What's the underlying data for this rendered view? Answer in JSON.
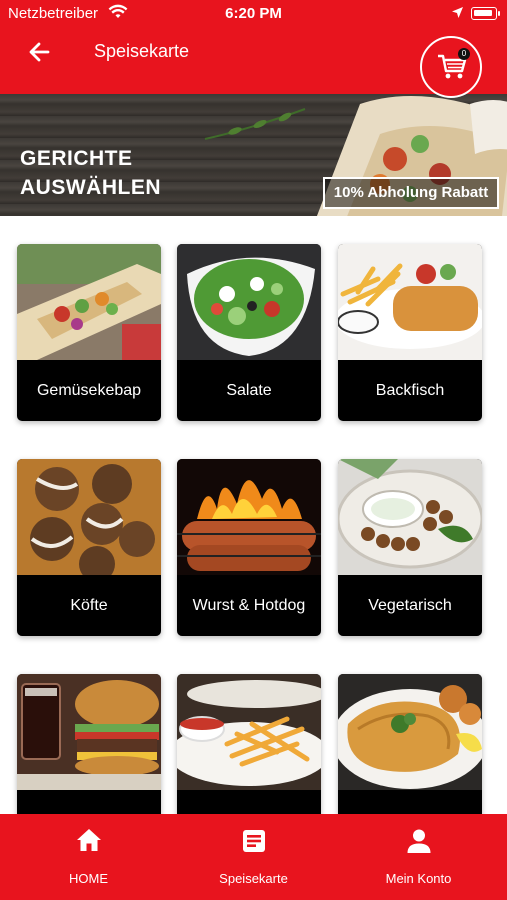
{
  "status_bar": {
    "carrier": "Netzbetreiber",
    "time": "6:20 PM"
  },
  "header": {
    "title": "Speisekarte",
    "cart_count": "0"
  },
  "banner": {
    "line1": "GERICHTE",
    "line2": "AUSWÄHLEN",
    "promo": "10% Abholung Rabatt"
  },
  "categories": [
    {
      "label": "Gemüsekebap",
      "image": "wrap-photo"
    },
    {
      "label": "Salate",
      "image": "salad-photo"
    },
    {
      "label": "Backfisch",
      "image": "fried-fish-photo"
    },
    {
      "label": "Köfte",
      "image": "meatballs-photo"
    },
    {
      "label": "Wurst & Hotdog",
      "image": "grill-sausage-photo"
    },
    {
      "label": "Vegetarisch",
      "image": "falafel-photo"
    },
    {
      "label": "",
      "image": "burger-photo"
    },
    {
      "label": "",
      "image": "fries-photo"
    },
    {
      "label": "",
      "image": "schnitzel-photo"
    }
  ],
  "tabbar": {
    "home": "HOME",
    "menu": "Speisekarte",
    "account": "Mein Konto"
  },
  "colors": {
    "brand_red": "#e8141e",
    "card_label_bg": "#000000"
  }
}
